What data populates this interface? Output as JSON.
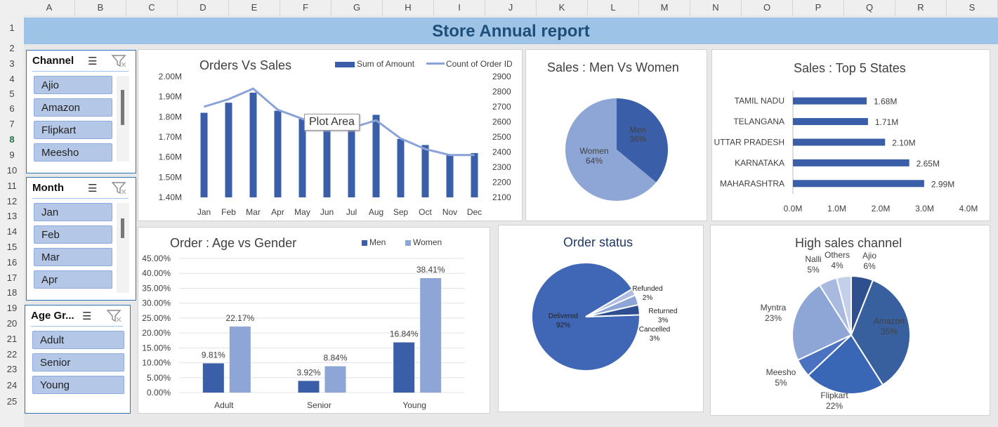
{
  "columns": [
    "A",
    "B",
    "C",
    "D",
    "E",
    "F",
    "G",
    "H",
    "I",
    "J",
    "K",
    "L",
    "M",
    "N",
    "O",
    "P",
    "Q",
    "R",
    "S"
  ],
  "rows": [
    "1",
    "2",
    "3",
    "4",
    "5",
    "6",
    "7",
    "8",
    "9",
    "10",
    "11",
    "12",
    "13",
    "14",
    "15",
    "16",
    "17",
    "18",
    "19",
    "20",
    "21",
    "22",
    "23",
    "24",
    "25"
  ],
  "selected_row": "8",
  "title": "Store Annual report",
  "slicers": {
    "channel": {
      "title": "Channel",
      "items": [
        "Ajio",
        "Amazon",
        "Flipkart",
        "Meesho"
      ]
    },
    "month": {
      "title": "Month",
      "items": [
        "Jan",
        "Feb",
        "Mar",
        "Apr"
      ]
    },
    "age": {
      "title": "Age Gr...",
      "items": [
        "Adult",
        "Senior",
        "Young"
      ]
    }
  },
  "tooltip": "Plot Area",
  "colors": {
    "dark": "#3a5ea8",
    "light": "#8ea6d6",
    "line": "#8aa3d8",
    "banner": "#9dc3e6"
  },
  "chart_data": [
    {
      "id": "orders_vs_sales",
      "type": "bar",
      "title": "Orders Vs Sales",
      "categories": [
        "Jan",
        "Feb",
        "Mar",
        "Apr",
        "May",
        "Jun",
        "Jul",
        "Aug",
        "Sep",
        "Oct",
        "Nov",
        "Dec"
      ],
      "series": [
        {
          "name": "Sum of Amount",
          "type": "bar",
          "axis": "left",
          "values": [
            1.82,
            1.87,
            1.92,
            1.83,
            1.79,
            1.74,
            1.74,
            1.81,
            1.69,
            1.66,
            1.61,
            1.62
          ]
        },
        {
          "name": "Count of Order ID",
          "type": "line",
          "axis": "right",
          "values": [
            2700,
            2750,
            2820,
            2680,
            2620,
            2570,
            2560,
            2610,
            2490,
            2420,
            2380,
            2380
          ]
        }
      ],
      "y_left_ticks": [
        "1.40M",
        "1.50M",
        "1.60M",
        "1.70M",
        "1.80M",
        "1.90M",
        "2.00M"
      ],
      "ylim_left": [
        1.4,
        2.0
      ],
      "y_right_ticks": [
        "2100",
        "2200",
        "2300",
        "2400",
        "2500",
        "2600",
        "2700",
        "2800",
        "2900"
      ],
      "ylim_right": [
        2100,
        2900
      ]
    },
    {
      "id": "men_vs_women",
      "type": "pie",
      "title": "Sales : Men Vs Women",
      "labels": [
        "Men",
        "Women"
      ],
      "values": [
        36,
        64
      ],
      "value_labels": [
        "36%",
        "64%"
      ],
      "colors": [
        "#3a5ea8",
        "#8ea6d6"
      ]
    },
    {
      "id": "top5_states",
      "type": "bar",
      "orientation": "horizontal",
      "title": "Sales : Top 5 States",
      "categories": [
        "TAMIL NADU",
        "TELANGANA",
        "UTTAR PRADESH",
        "KARNATAKA",
        "MAHARASHTRA"
      ],
      "values": [
        1.68,
        1.71,
        2.1,
        2.65,
        2.99
      ],
      "value_labels": [
        "1.68M",
        "1.71M",
        "2.10M",
        "2.65M",
        "2.99M"
      ],
      "x_ticks": [
        "0.0M",
        "1.0M",
        "2.0M",
        "3.0M",
        "4.0M"
      ],
      "xlim": [
        0,
        4
      ]
    },
    {
      "id": "age_vs_gender",
      "type": "bar",
      "title": "Order : Age vs Gender",
      "categories": [
        "Adult",
        "Senior",
        "Young"
      ],
      "series": [
        {
          "name": "Men",
          "values": [
            9.81,
            3.92,
            16.84
          ],
          "value_labels": [
            "9.81%",
            "3.92%",
            "16.84%"
          ]
        },
        {
          "name": "Women",
          "values": [
            22.17,
            8.84,
            38.41
          ],
          "value_labels": [
            "22.17%",
            "8.84%",
            "38.41%"
          ]
        }
      ],
      "y_ticks": [
        "0.00%",
        "5.00%",
        "10.00%",
        "15.00%",
        "20.00%",
        "25.00%",
        "30.00%",
        "35.00%",
        "40.00%",
        "45.00%"
      ],
      "ylim": [
        0,
        45
      ]
    },
    {
      "id": "order_status",
      "type": "pie",
      "title": "Order status",
      "labels": [
        "Delivered",
        "Refunded",
        "Returned",
        "Cancelled"
      ],
      "values": [
        92,
        2,
        3,
        3
      ],
      "value_labels": [
        "92%",
        "2%",
        "3%",
        "3%"
      ],
      "colors": [
        "#3f67b5",
        "#aebde0",
        "#8ea6d6",
        "#2d4f92"
      ]
    },
    {
      "id": "high_sales_channel",
      "type": "pie",
      "title": "High sales channel",
      "labels": [
        "Ajio",
        "Amazon",
        "Flipkart",
        "Meesho",
        "Myntra",
        "Nalli",
        "Others"
      ],
      "values": [
        6,
        35,
        22,
        5,
        23,
        5,
        4
      ],
      "value_labels": [
        "6%",
        "35%",
        "22%",
        "5%",
        "23%",
        "5%",
        "4%"
      ],
      "colors": [
        "#2f508f",
        "#38609f",
        "#3a66b6",
        "#4a72c0",
        "#8ea6d6",
        "#a9b9e0",
        "#c4d0ea"
      ]
    }
  ]
}
